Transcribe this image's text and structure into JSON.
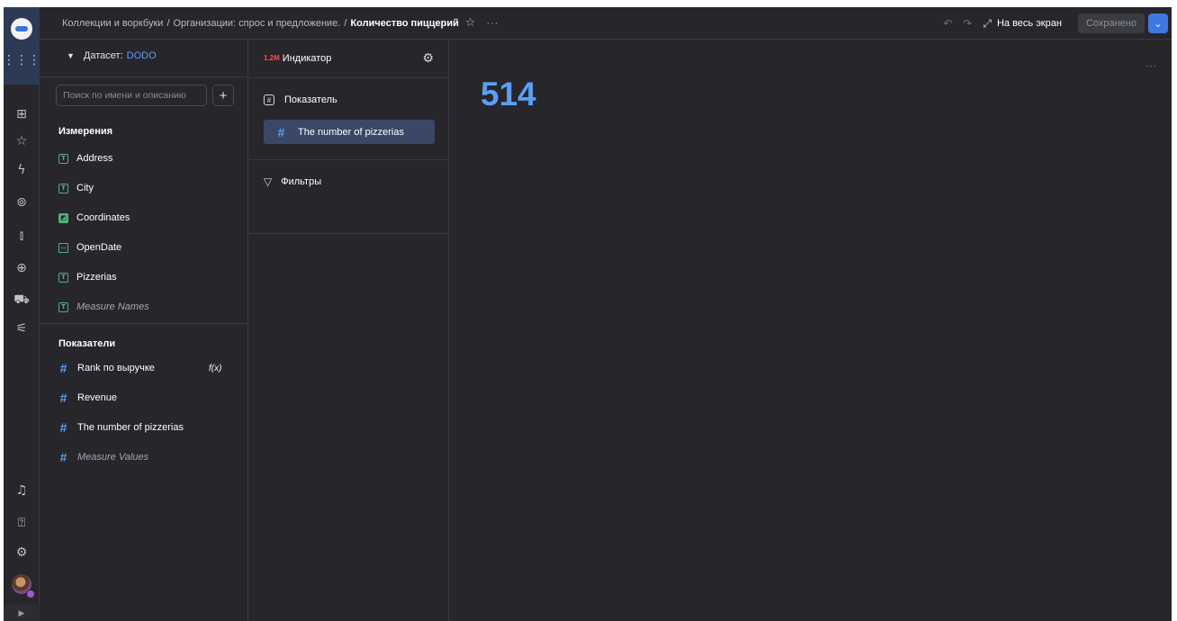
{
  "breadcrumb": {
    "path": [
      "Коллекции и воркбуки",
      "Организации: спрос и предложение."
    ],
    "separator": "/",
    "current": "Количество пиццерий"
  },
  "topbar": {
    "more": "···",
    "fullscreen_label": "На весь экран",
    "saved_label": "Сохранено"
  },
  "dataset": {
    "label": "Датасет:",
    "name": "DODO",
    "search_placeholder": "Поиск по имени и описанию",
    "add": "+",
    "dimensions_title": "Измерения",
    "dimensions": [
      {
        "label": "Address",
        "type": "T"
      },
      {
        "label": "City",
        "type": "T"
      },
      {
        "label": "Coordinates",
        "type": "geo"
      },
      {
        "label": "OpenDate",
        "type": "date"
      },
      {
        "label": "Pizzerias",
        "type": "T"
      },
      {
        "label": "Measure Names",
        "type": "T"
      }
    ],
    "measures_title": "Показатели",
    "measures": [
      {
        "label": "Rank по выручке",
        "formula": "f(x)"
      },
      {
        "label": "Revenue"
      },
      {
        "label": "The number of pizzerias"
      },
      {
        "label": "Measure Values"
      }
    ]
  },
  "visual": {
    "badge": "1.2M",
    "type_label": "Индикатор",
    "measure_section": "Показатель",
    "measure_item": "The number of pizzerias",
    "filters_section": "Фильтры"
  },
  "canvas": {
    "value": "514",
    "more": "···"
  },
  "colors": {
    "background": "#26262b",
    "accent": "#3f78e0",
    "value": "#5a9ff5",
    "dimension": "#4fb27a",
    "measure": "#5f9cf2"
  }
}
